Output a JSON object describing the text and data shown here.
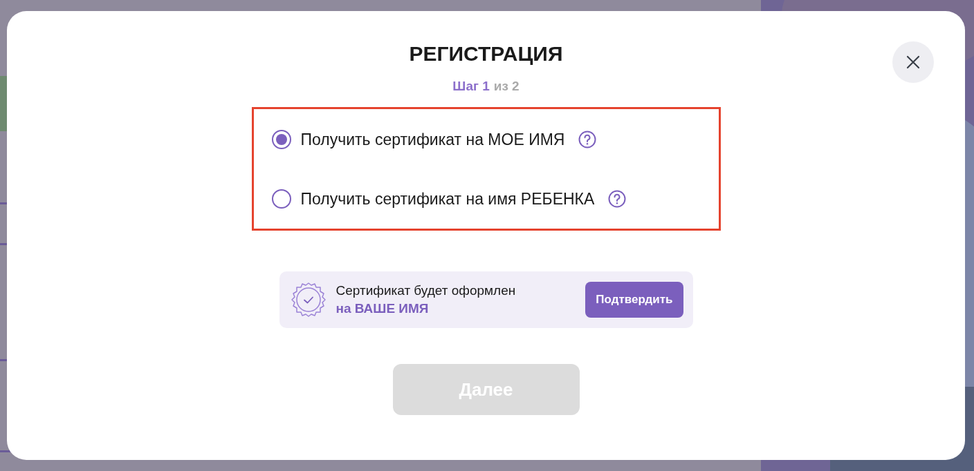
{
  "dialog": {
    "title": "РЕГИСТРАЦИЯ",
    "step_current": "Шаг 1",
    "step_total": "из 2",
    "options": [
      {
        "label": "Получить сертификат на МОЕ ИМЯ",
        "selected": true
      },
      {
        "label": "Получить сертификат на имя РЕБЕНКА",
        "selected": false
      }
    ],
    "notice": {
      "text": "Сертификат будет оформлен",
      "highlight": "на ВАШЕ ИМЯ",
      "button": "Подтвердить"
    },
    "next_button": {
      "label": "Далее",
      "disabled": true
    }
  }
}
